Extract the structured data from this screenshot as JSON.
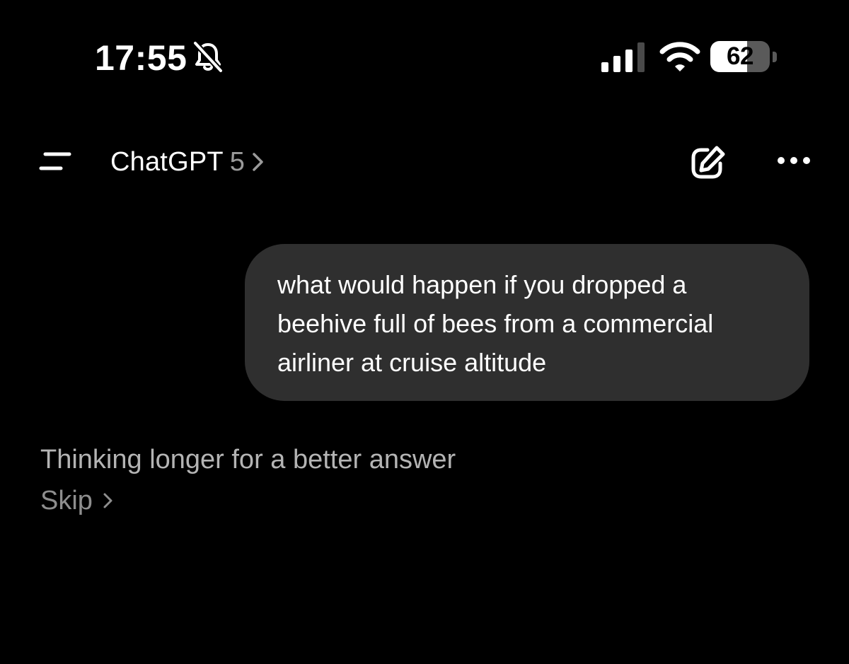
{
  "status_bar": {
    "time": "17:55",
    "battery_level": "62",
    "battery_fraction": 0.62,
    "icons": [
      "bell-slash-icon",
      "cellular-signal-icon",
      "wifi-icon",
      "battery-icon"
    ]
  },
  "header": {
    "app_title": "ChatGPT",
    "model_version": "5",
    "icons": [
      "menu-icon",
      "chevron-right-icon",
      "new-chat-icon",
      "more-icon"
    ]
  },
  "conversation": {
    "user_message": "what would happen if you dropped a\nbeehive full of bees from a commercial\nairliner at cruise altitude",
    "thinking_status": "Thinking longer for a better answer",
    "skip_label": "Skip"
  },
  "colors": {
    "background": "#000000",
    "bubble": "#2f2f2f",
    "primary_text": "#ffffff",
    "secondary_text": "#b4b4b4",
    "muted_text": "#8e8e8e"
  }
}
